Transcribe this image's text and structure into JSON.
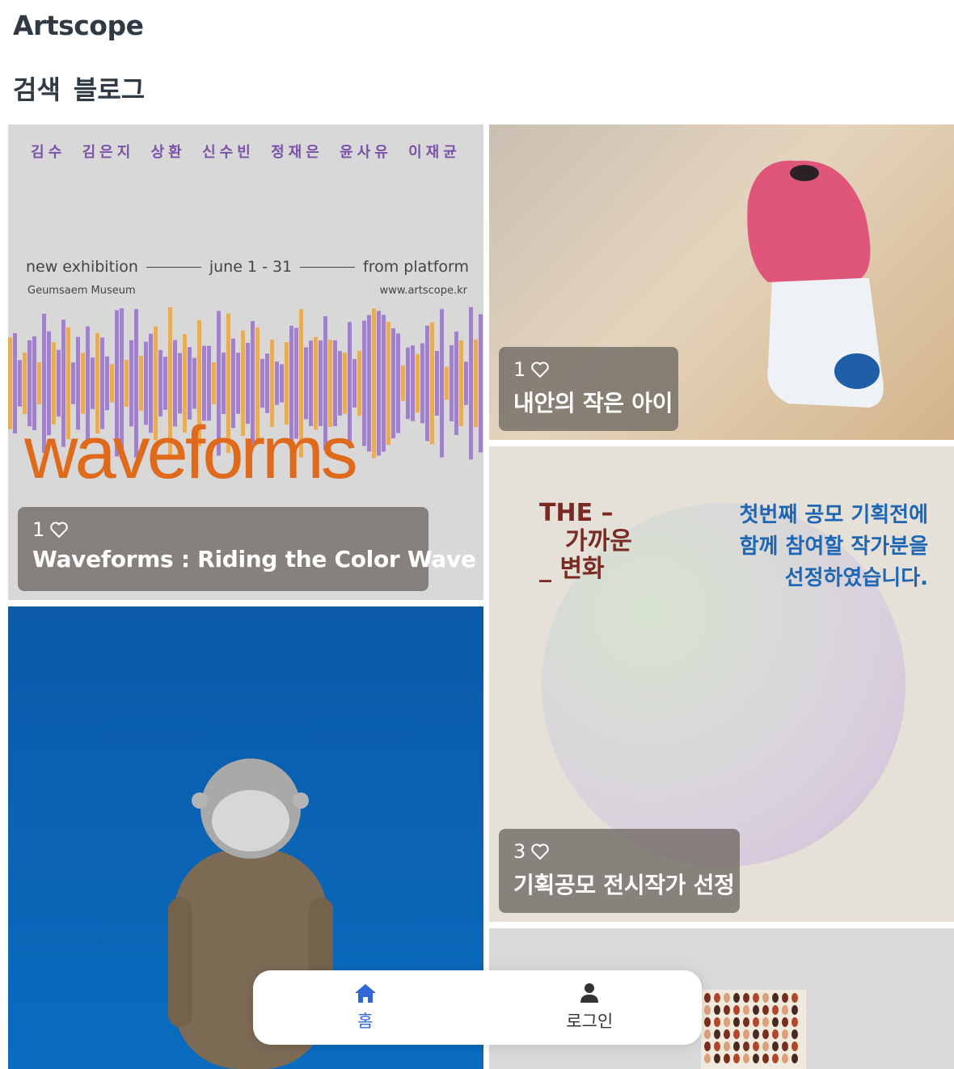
{
  "app": {
    "title": "Artscope"
  },
  "nav": {
    "search": "검색",
    "blog": "블로그"
  },
  "cards": [
    {
      "likes": "1",
      "title": "Waveforms : Riding the Color Wave",
      "poster": {
        "names": [
          "김수",
          "김은지",
          "상환",
          "신수빈",
          "정재은",
          "윤사유",
          "이재균"
        ],
        "line_left": "new exhibition",
        "line_mid": "june 1 - 31",
        "line_right": "from platform",
        "sub_left": "Geumsaem Museum",
        "sub_right": "www.artscope.kr",
        "big": "waveforms"
      }
    },
    {
      "likes": "1",
      "title": "내안의 작은 아이"
    },
    {
      "likes": "3",
      "title": "기획공모 전시작가 선정",
      "poster": {
        "left_lines": [
          "THE –",
          "가까운",
          "_ 변화"
        ],
        "right_lines": [
          "첫번째 공모 기획전에",
          "함께 참여할 작가분을",
          "선정하였습니다."
        ]
      }
    }
  ],
  "bottom_nav": {
    "home": "홈",
    "login": "로그인"
  },
  "colors": {
    "accent": "#2f68d6",
    "purple": "#7a52a8",
    "orange": "#e06a1b"
  }
}
